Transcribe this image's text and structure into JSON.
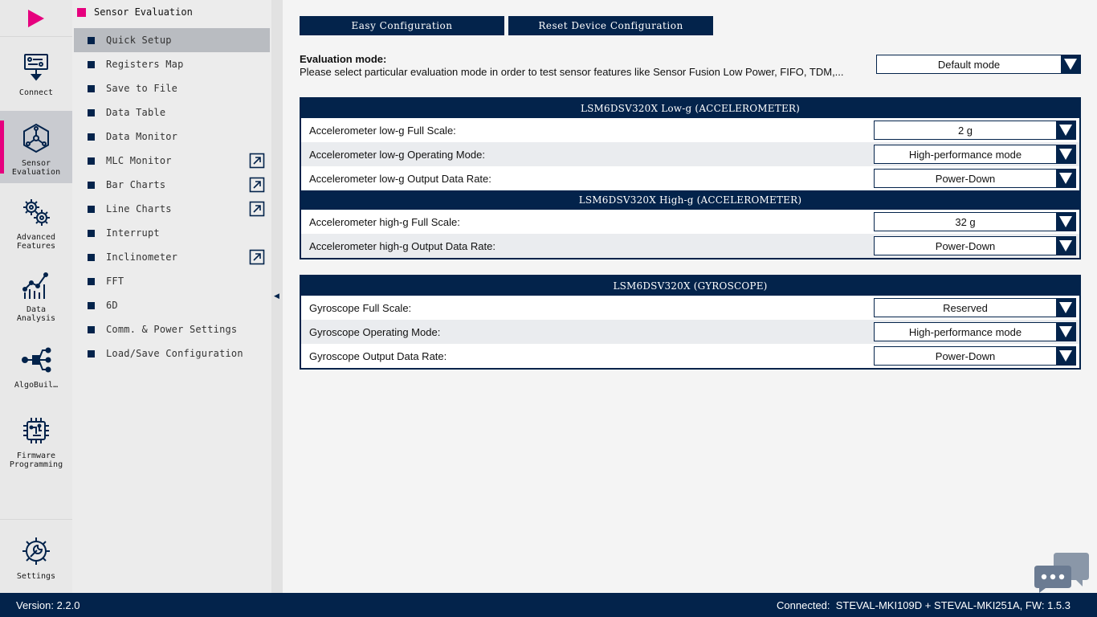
{
  "rail": {
    "items": [
      {
        "label": "Connect",
        "icon": "connect-icon"
      },
      {
        "label": "Sensor\nEvaluation",
        "icon": "sensor-evaluation-icon",
        "active": true
      },
      {
        "label": "Advanced\nFeatures",
        "icon": "gears-icon"
      },
      {
        "label": "Data\nAnalysis",
        "icon": "chart-icon"
      },
      {
        "label": "AlgoBuil…",
        "icon": "algo-builder-icon"
      },
      {
        "label": "Firmware\nProgramming",
        "icon": "chip-icon"
      },
      {
        "label": "Settings",
        "icon": "settings-icon"
      }
    ]
  },
  "submenu": {
    "title": "Sensor Evaluation",
    "items": [
      {
        "label": "Quick Setup",
        "active": true
      },
      {
        "label": "Registers Map"
      },
      {
        "label": "Save to File"
      },
      {
        "label": "Data Table"
      },
      {
        "label": "Data Monitor"
      },
      {
        "label": "MLC Monitor",
        "external": true
      },
      {
        "label": "Bar Charts",
        "external": true
      },
      {
        "label": "Line Charts",
        "external": true
      },
      {
        "label": "Interrupt"
      },
      {
        "label": "Inclinometer",
        "external": true
      },
      {
        "label": "FFT"
      },
      {
        "label": "6D"
      },
      {
        "label": "Comm. & Power Settings"
      },
      {
        "label": "Load/Save Configuration"
      }
    ]
  },
  "main": {
    "easy_config": "Easy Configuration",
    "reset_config": "Reset Device Configuration",
    "eval_title": "Evaluation mode:",
    "eval_desc": "Please select particular evaluation mode in order to test sensor features like Sensor Fusion Low Power, FIFO, TDM,...",
    "eval_value": "Default mode",
    "panels": [
      {
        "sections": [
          {
            "header": "LSM6DSV320X Low-g (ACCELEROMETER)",
            "rows": [
              {
                "label": "Accelerometer low-g Full Scale:",
                "value": "2 g"
              },
              {
                "label": "Accelerometer low-g Operating Mode:",
                "value": "High-performance mode"
              },
              {
                "label": "Accelerometer low-g Output Data Rate:",
                "value": "Power-Down"
              }
            ]
          },
          {
            "header": "LSM6DSV320X High-g (ACCELEROMETER)",
            "rows": [
              {
                "label": "Accelerometer high-g Full Scale:",
                "value": "32 g"
              },
              {
                "label": "Accelerometer high-g Output Data Rate:",
                "value": "Power-Down"
              }
            ]
          }
        ]
      },
      {
        "sections": [
          {
            "header": "LSM6DSV320X (GYROSCOPE)",
            "rows": [
              {
                "label": "Gyroscope Full Scale:",
                "value": "Reserved"
              },
              {
                "label": "Gyroscope Operating Mode:",
                "value": "High-performance mode"
              },
              {
                "label": "Gyroscope Output Data Rate:",
                "value": "Power-Down"
              }
            ]
          }
        ]
      }
    ]
  },
  "footer": {
    "version": "Version: 2.2.0",
    "connected": "Connected:  STEVAL-MKI109D + STEVAL-MKI251A, FW: 1.5.3"
  },
  "colors": {
    "navy": "#03234b",
    "accent": "#e6007e"
  }
}
